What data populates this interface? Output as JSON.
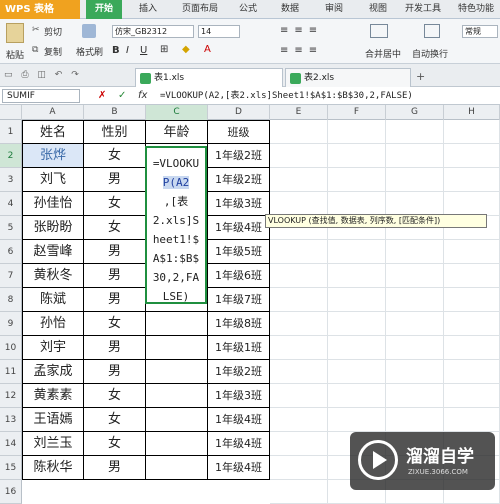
{
  "app": {
    "logo": "WPS 表格"
  },
  "ribbon_tabs": [
    "开始",
    "插入",
    "页面布局",
    "公式",
    "数据",
    "审阅",
    "视图",
    "开发工具",
    "特色功能"
  ],
  "ribbon": {
    "cut": "剪切",
    "copy": "复制",
    "paste": "粘贴",
    "format_painter": "格式刷",
    "font": "仿宋_GB2312",
    "size": "14",
    "merge": "合并居中",
    "autowrap": "自动换行",
    "style": "常规"
  },
  "file_tabs": [
    "表1.xls",
    "表2.xls"
  ],
  "formula_bar": {
    "name_box": "SUMIF",
    "formula": "=VLOOKUP(A2,[表2.xls]Sheet1!$A$1:$B$30,2,FALSE)"
  },
  "columns": [
    "A",
    "B",
    "C",
    "D",
    "E",
    "F",
    "G",
    "H"
  ],
  "rows": [
    "1",
    "2",
    "3",
    "4",
    "5",
    "6",
    "7",
    "8",
    "9",
    "10",
    "11",
    "12",
    "13",
    "14",
    "15",
    "16"
  ],
  "table": {
    "headers": [
      "姓名",
      "性别",
      "年龄",
      "班级"
    ],
    "data": [
      [
        "张烨",
        "女",
        "",
        "1年级2班"
      ],
      [
        "刘飞",
        "男",
        "",
        "1年级2班"
      ],
      [
        "孙佳怡",
        "女",
        "",
        "1年级3班"
      ],
      [
        "张盼盼",
        "女",
        "",
        "1年级4班"
      ],
      [
        "赵雪峰",
        "男",
        "",
        "1年级5班"
      ],
      [
        "黄秋冬",
        "男",
        "",
        "1年级6班"
      ],
      [
        "陈斌",
        "男",
        "",
        "1年级7班"
      ],
      [
        "孙怡",
        "女",
        "",
        "1年级8班"
      ],
      [
        "刘宇",
        "男",
        "",
        "1年级1班"
      ],
      [
        "孟家成",
        "男",
        "",
        "1年级2班"
      ],
      [
        "黄素素",
        "女",
        "",
        "1年级3班"
      ],
      [
        "王语嫣",
        "女",
        "",
        "1年级4班"
      ],
      [
        "刘兰玉",
        "女",
        "",
        "1年级4班"
      ],
      [
        "陈秋华",
        "男",
        "",
        "1年级4班"
      ]
    ]
  },
  "edit_lines": [
    "=VLOOKU",
    "P(A2",
    ",[表",
    "2.xls]S",
    "heet1!$",
    "A$1:$B$",
    "30,2,FA",
    "LSE)"
  ],
  "tooltip": "VLOOKUP (查找值, 数据表, 列序数, [匹配条件])",
  "watermark": {
    "title": "溜溜自学",
    "url": "ZIXUE.3066.COM"
  }
}
